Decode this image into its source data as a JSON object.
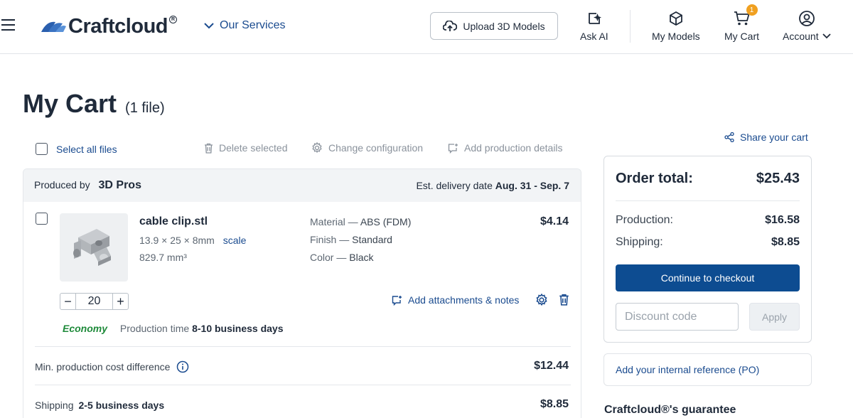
{
  "header": {
    "brand": "Craftcloud",
    "services_label": "Our Services",
    "upload_label": "Upload 3D Models",
    "ask_ai_label": "Ask AI",
    "my_models_label": "My Models",
    "my_cart_label": "My Cart",
    "cart_badge": "1",
    "account_label": "Account"
  },
  "page": {
    "title": "My Cart",
    "file_count": "(1 file)"
  },
  "toolbar": {
    "select_all": "Select all files",
    "delete_selected": "Delete selected",
    "change_configuration": "Change configuration",
    "add_production_details": "Add production details",
    "share_cart": "Share your cart"
  },
  "cart": {
    "produced_by_label": "Produced by",
    "vendor": "3D Pros",
    "delivery_label": "Est. delivery date",
    "delivery_dates": "Aug. 31 - Sep. 7",
    "item": {
      "file_name": "cable clip.stl",
      "dimensions": "13.9 × 25 × 8mm",
      "scale_label": "scale",
      "volume": "829.7 mm³",
      "material_label": "Material —",
      "material": "ABS (FDM)",
      "finish_label": "Finish —",
      "finish": "Standard",
      "color_label": "Color —",
      "color": "Black",
      "price": "$4.14",
      "quantity": "20",
      "attachments_label": "Add attachments & notes"
    },
    "production": {
      "speed": "Economy",
      "time_label": "Production time",
      "time_value": "8-10 business days"
    },
    "min_cost_label": "Min. production cost difference",
    "min_cost_value": "$12.44",
    "shipping_label": "Shipping",
    "shipping_days": "2-5 business days",
    "shipping_value": "$8.85"
  },
  "summary": {
    "title": "Order total:",
    "total": "$25.43",
    "production_label": "Production:",
    "production_value": "$16.58",
    "shipping_label": "Shipping:",
    "shipping_value": "$8.85",
    "checkout_label": "Continue to checkout",
    "discount_placeholder": "Discount code",
    "apply_label": "Apply",
    "reference_label": "Add your internal reference (PO)",
    "guarantee_title": "Craftcloud®'s guarantee"
  },
  "colors": {
    "primary": "#0d4c91",
    "link": "#1a4b8f",
    "economy": "#1e8a3a",
    "badge": "#f0a020"
  },
  "icons": [
    "menu-icon",
    "chevron-down-icon",
    "cloud-upload-icon",
    "ai-sparkle-icon",
    "cube-icon",
    "cart-icon",
    "user-circle-icon",
    "trash-icon",
    "gear-icon",
    "note-add-icon",
    "share-icon",
    "info-icon"
  ]
}
